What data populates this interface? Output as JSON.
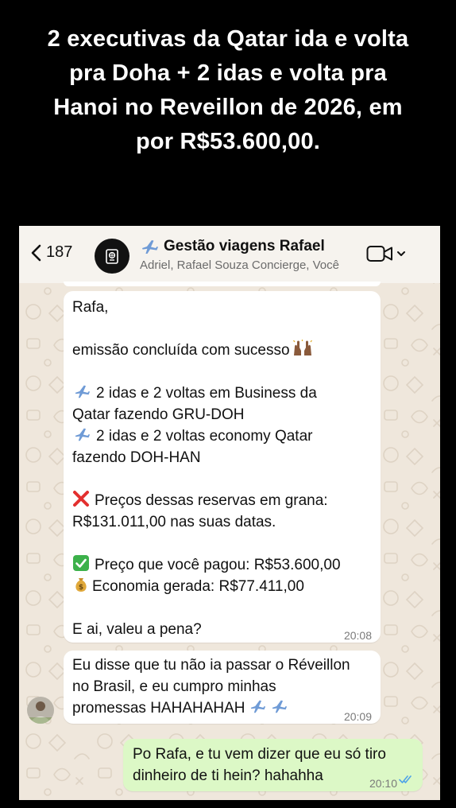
{
  "headline": {
    "line1": "2 executivas da Qatar ida e volta",
    "line2": "pra Doha + 2 idas e volta pra",
    "line3": "Hanoi no Reveillon de 2026, em",
    "line4": "por R$53.600,00."
  },
  "chat_header": {
    "back_count": "187",
    "group_title": "Gestão viagens Rafael",
    "title_icon": "airplane-icon",
    "members": "Adriel, Rafael Souza Concierge, Você",
    "video_icon": "video-call-icon"
  },
  "messages": [
    {
      "from": "incoming",
      "lines": {
        "l1": "Rafa,",
        "l2": "emissão concluída com sucesso",
        "l3": "2 idas e 2 voltas em Business da",
        "l4": "Qatar fazendo GRU-DOH",
        "l5": "2 idas e 2 voltas economy Qatar",
        "l6": "fazendo DOH-HAN",
        "l7": "Preços dessas reservas em grana:",
        "l8": "R$131.011,00 nas suas datas.",
        "l9": "Preço que você pagou: R$53.600,00",
        "l10": "Economia gerada: R$77.411,00",
        "l11": "E ai, valeu a pena?"
      },
      "time": "20:08"
    },
    {
      "from": "incoming",
      "lines": {
        "l1": "Eu disse que tu não ia passar o Réveillon",
        "l2": "no Brasil, e eu cumpro minhas",
        "l3": "promessas HAHAHAHAH"
      },
      "time": "20:09"
    },
    {
      "from": "outgoing",
      "lines": {
        "l1": "Po Rafa, e tu vem dizer que eu só tiro",
        "l2": "dinheiro de ti hein? hahahha"
      },
      "time": "20:10",
      "status": "read"
    }
  ],
  "colors": {
    "incoming_bubble": "#ffffff",
    "outgoing_bubble": "#dcf8c6",
    "read_ticks": "#4fa3e8",
    "wallpaper": "#efe7dc"
  }
}
